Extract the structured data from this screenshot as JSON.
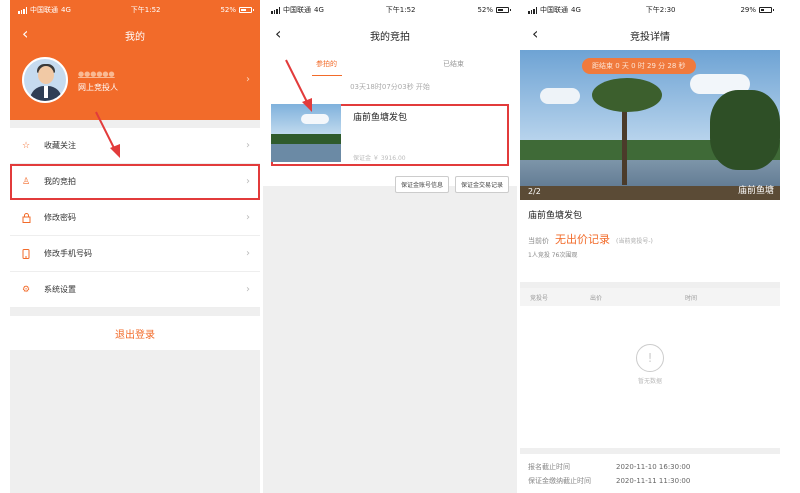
{
  "phone1": {
    "status": {
      "carrier": "中国联通",
      "network": "4G",
      "time": "下午1:52",
      "battery": "52%",
      "battery_level": 0.52
    },
    "nav": {
      "title": "我的"
    },
    "profile": {
      "username_masked": "●●●●●●",
      "role": "网上竞投人"
    },
    "menu": [
      {
        "label": "收藏关注",
        "icon": "star-icon"
      },
      {
        "label": "我的竞拍",
        "icon": "person-icon"
      },
      {
        "label": "修改密码",
        "icon": "lock-icon"
      },
      {
        "label": "修改手机号码",
        "icon": "phone-icon"
      },
      {
        "label": "系统设置",
        "icon": "gear-icon"
      }
    ],
    "logout": "退出登录"
  },
  "phone2": {
    "status": {
      "carrier": "中国联通",
      "network": "4G",
      "time": "下午1:52",
      "battery": "52%",
      "battery_level": 0.52
    },
    "nav": {
      "title": "我的竞拍"
    },
    "tabs": [
      "参拍的",
      "已结束"
    ],
    "countdown": "03天18时07分03秒 开始",
    "item": {
      "title": "庙前鱼塘发包",
      "deposit": "保证金 ￥ 3916.00"
    },
    "buttons": {
      "deposit_info": "保证金账号信息",
      "deposit_records": "保证金交易记录"
    }
  },
  "phone3": {
    "status": {
      "carrier": "中国联通",
      "network": "4G",
      "time": "下午2:30",
      "battery": "29%",
      "battery_level": 0.29
    },
    "nav": {
      "title": "竞投详情"
    },
    "timer": "距结束 0 天 0 时 29 分 28 秒",
    "pager": "2/2",
    "watermark": "庙前鱼塘",
    "title": "庙前鱼塘发包",
    "price_label": "当前价",
    "price_value": "无出价记录",
    "price_hint": "(当前竞投号-)",
    "stats": "1人竞投   76次围观",
    "table_headers": [
      "竞投号",
      "出价",
      "时间"
    ],
    "empty_text": "暂无数据",
    "footer": [
      {
        "label": "报名截止时间",
        "value": "2020-11-10 16:30:00"
      },
      {
        "label": "保证金缴纳截止时间",
        "value": "2020-11-11 11:30:00"
      }
    ]
  }
}
